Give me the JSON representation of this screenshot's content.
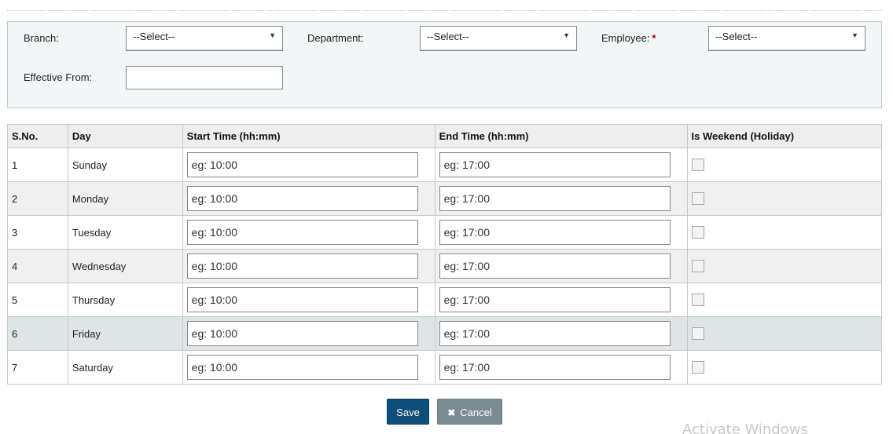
{
  "form": {
    "branch_label": "Branch:",
    "branch_value": "--Select--",
    "department_label": "Department:",
    "department_value": "--Select--",
    "employee_label": "Employee:",
    "employee_required": "*",
    "employee_value": "--Select--",
    "effective_from_label": "Effective From:",
    "effective_from_value": ""
  },
  "table": {
    "headers": [
      "S.No.",
      "Day",
      "Start Time (hh:mm)",
      "End Time (hh:mm)",
      "Is Weekend (Holiday)"
    ],
    "start_placeholder": "eg: 10:00",
    "end_placeholder": "eg: 17:00",
    "rows": [
      {
        "sno": "1",
        "day": "Sunday",
        "weekend": false
      },
      {
        "sno": "2",
        "day": "Monday",
        "weekend": false
      },
      {
        "sno": "3",
        "day": "Tuesday",
        "weekend": false
      },
      {
        "sno": "4",
        "day": "Wednesday",
        "weekend": false
      },
      {
        "sno": "5",
        "day": "Thursday",
        "weekend": false
      },
      {
        "sno": "6",
        "day": "Friday",
        "weekend": false
      },
      {
        "sno": "7",
        "day": "Saturday",
        "weekend": false
      }
    ]
  },
  "actions": {
    "save_label": "Save",
    "cancel_label": "Cancel",
    "cancel_icon": "close-icon"
  },
  "watermark": "Activate Windows",
  "colors": {
    "save_bg": "#0e4e78",
    "cancel_bg": "#7a8c91",
    "required": "#c00000",
    "highlight_row": "#dfe5e7"
  }
}
